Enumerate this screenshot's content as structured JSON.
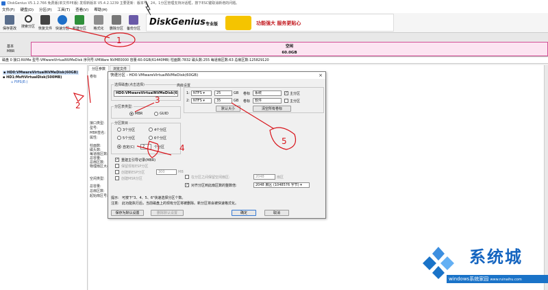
{
  "window": {
    "title": "DiskGenius V5.1.2.766 免费版(单文件PE版)  发现新版本 V5.4.2.1239 主要更新：版本号：24，1分区管理支持对话框，按下ESC键取消新增的问题。"
  },
  "menu": [
    "文件(F)",
    "硬盘(D)",
    "分区(P)",
    "工具(T)",
    "查看(V)",
    "帮助(H)"
  ],
  "toolbar": {
    "save": "保存更改",
    "search": "搜索分区",
    "recover": "恢复文件",
    "quick_partition": "快速分区",
    "new_partition": "新建分区",
    "format": "格式化",
    "delete": "删除分区",
    "backup": "备份分区"
  },
  "banner": {
    "brand": "DiskGenius",
    "brand_suffix": "专业版",
    "promo": "功能强大 服务更贴心"
  },
  "disk_area": {
    "label_basic": "基本",
    "label_mbr": "MBR",
    "free_label": "空闲",
    "free_size": "60.0GB"
  },
  "info_strip": "磁盘 0 接口:NVMe  型号:VMwareVirtualNVMeDisk  序列号:VMWare NVME0000  容量:60.0GB(61440MB)  柱面数:7832  磁头数:255  每道扇区数:63  总扇区数:125829120",
  "tree": {
    "disk0": "HD0:VMwareVirtualNVMeDisk(60GB)",
    "disk1": "HD1:MsftVirtualDisk(500MB)",
    "disk1_part": "FIPS(E:)"
  },
  "right_tabs": [
    "分区参数",
    "浏览文件"
  ],
  "right_labels": {
    "col_label": "卷标",
    "iface": "接口类型:",
    "model": "型号:",
    "mbr_sig": "MBR签名:",
    "attr": "属性:",
    "cyl": "柱面数:",
    "heads": "磁头数:",
    "spt": "每道扇区数:",
    "total_cap": "总容量:",
    "total_bytes": "总扇区数:",
    "phys_sector": "物理扇区大小:",
    "free_type": "空闲类型:",
    "total_cap2": "总容量:",
    "total_sectors2": "总扇区数:",
    "start_sector": "起始扇区号:"
  },
  "dialog": {
    "title": "快速分区 - HD0:VMwareVirtualNVMeDisk(60GB)",
    "disk_group": "选择磁盘(点击选择)",
    "disk_value": "HD0:VMwareVirtualNVMeDisk(60",
    "table_type_group": "分区表类型:",
    "mbr": "MBR",
    "guid": "GUID",
    "count_group": "分区数目",
    "opt3": "3个分区",
    "opt4": "4个分区",
    "opt5": "5个分区",
    "opt6": "6个分区",
    "custom": "自定(C)",
    "custom_value": "2",
    "custom_suffix": "个分区",
    "rebuild_mbr": "重建主引导记录(MBR)",
    "keep_hidden": "保留现有ESP分区",
    "create_new_esp": "创建新ESP分区",
    "esp_size": "300",
    "esp_unit": "MB",
    "create_msr": "创建MSR分区",
    "advanced_group": "高级设置",
    "rows": [
      {
        "idx": "1:",
        "fs": "NTFS",
        "size": "25",
        "unit": "GB",
        "vol_label": "卷标",
        "vol": "系统",
        "primary": "主分区"
      },
      {
        "idx": "2:",
        "fs": "NTFS",
        "size": "35",
        "unit": "GB",
        "vol_label": "卷标",
        "vol": "软件",
        "primary": "主分区"
      }
    ],
    "default_size": "默认大小",
    "clear_labels": "清空所有卷标",
    "reserve_gap": "在分区之间保留空闲扇区:",
    "reserve_value": "2048",
    "reserve_unit": "扇区",
    "align": "对齐分区到此扇区数的整数倍:",
    "align_value": "2048 扇区 (1048576 字节)",
    "hint1_prefix": "提示:",
    "hint1": "可按下\"3、4、5、6\"快速选择分区个数。",
    "hint2_prefix": "注意:",
    "hint2": "此功能执行后，当前磁盘上的现有分区将被删除。新分区将会被快速格式化。",
    "save_default": "保存为默认设置",
    "delete_default": "删除默认设置",
    "ok": "确定",
    "cancel": "取消"
  },
  "annotations": [
    "1",
    "2",
    "3",
    "4",
    "5"
  ],
  "watermark": {
    "text": "系统城",
    "url": "windows系统家园",
    "site": "www.ruinaihu.com"
  },
  "colors": {
    "free_fill": "#fce4f1",
    "free_border": "#d24f95",
    "annotation_red": "#d8141b",
    "watermark_blue": "#1a73c8"
  }
}
